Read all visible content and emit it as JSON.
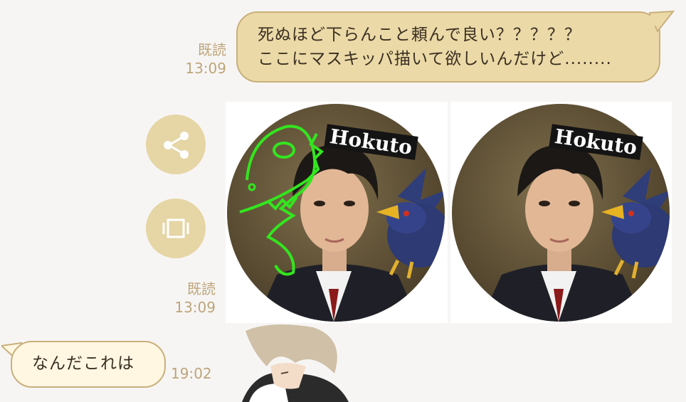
{
  "messages": {
    "outgoing_1": {
      "read": "既読",
      "time": "13:09",
      "lines": [
        "死ぬほど下らんこと頼んで良い？？？？？",
        "ここにマスキッパ描いて欲しいんだけど........"
      ]
    },
    "outgoing_images": {
      "read": "既読",
      "time": "13:09",
      "photo_label_left": "Hokuto",
      "photo_label_right": "Hokuto"
    },
    "incoming_1": {
      "text": "なんだこれは",
      "time": "19:02"
    }
  },
  "actions": {
    "share_icon": "share-icon",
    "expand_icon": "expand-icon"
  },
  "colors": {
    "background": "#f7f5f4",
    "outgoing_bubble": "#ebd9a7",
    "incoming_bubble": "#fff7e2",
    "bubble_border": "#c9b07b",
    "meta_text": "#bda57a",
    "action_button": "#e6d5a5",
    "doodle": "#33e51f"
  }
}
